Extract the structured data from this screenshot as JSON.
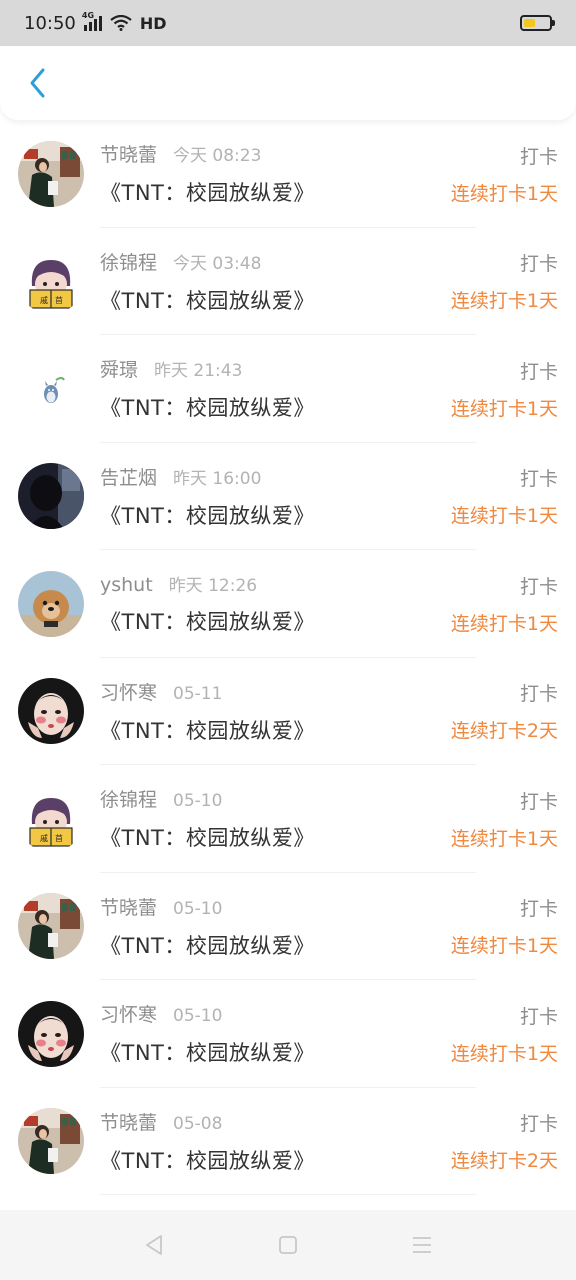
{
  "status_bar": {
    "time": "10:50",
    "network": "4G",
    "hd": "HD",
    "battery_level": 0.45
  },
  "header": {
    "back_icon": "chevron-left-icon",
    "accent_color": "#2f9fd8"
  },
  "colors": {
    "streak": "#f0883e",
    "secondary_text": "#8e8e8e",
    "time_text": "#b3b3b3",
    "title_text": "#333333"
  },
  "feed": [
    {
      "name": "节晓蕾",
      "time": "今天 08:23",
      "title": "《TNT：校园放纵爱》",
      "action": "打卡",
      "streak": "连续打卡1天",
      "avatar": "photo-girl-street"
    },
    {
      "name": "徐锦程",
      "time": "今天 03:48",
      "title": "《TNT：校园放纵爱》",
      "action": "打卡",
      "streak": "连续打卡1天",
      "avatar": "cartoon-reader"
    },
    {
      "name": "舜璟",
      "time": "昨天 21:43",
      "title": "《TNT：校园放纵爱》",
      "action": "打卡",
      "streak": "连续打卡1天",
      "avatar": "totoro-mini"
    },
    {
      "name": "告芷烟",
      "time": "昨天 16:00",
      "title": "《TNT：校园放纵爱》",
      "action": "打卡",
      "streak": "连续打卡1天",
      "avatar": "photo-dark-hair"
    },
    {
      "name": "yshut",
      "time": "昨天 12:26",
      "title": "《TNT：校园放纵爱》",
      "action": "打卡",
      "streak": "连续打卡1天",
      "avatar": "photo-dog"
    },
    {
      "name": "习怀寒",
      "time": "05-11",
      "title": "《TNT：校园放纵爱》",
      "action": "打卡",
      "streak": "连续打卡2天",
      "avatar": "photo-girl-face"
    },
    {
      "name": "徐锦程",
      "time": "05-10",
      "title": "《TNT：校园放纵爱》",
      "action": "打卡",
      "streak": "连续打卡1天",
      "avatar": "cartoon-reader"
    },
    {
      "name": "节晓蕾",
      "time": "05-10",
      "title": "《TNT：校园放纵爱》",
      "action": "打卡",
      "streak": "连续打卡1天",
      "avatar": "photo-girl-street"
    },
    {
      "name": "习怀寒",
      "time": "05-10",
      "title": "《TNT：校园放纵爱》",
      "action": "打卡",
      "streak": "连续打卡1天",
      "avatar": "photo-girl-face"
    },
    {
      "name": "节晓蕾",
      "time": "05-08",
      "title": "《TNT：校园放纵爱》",
      "action": "打卡",
      "streak": "连续打卡2天",
      "avatar": "photo-girl-street"
    }
  ],
  "nav_bar": {
    "icons": [
      "back-triangle-icon",
      "home-square-icon",
      "menu-lines-icon"
    ]
  }
}
